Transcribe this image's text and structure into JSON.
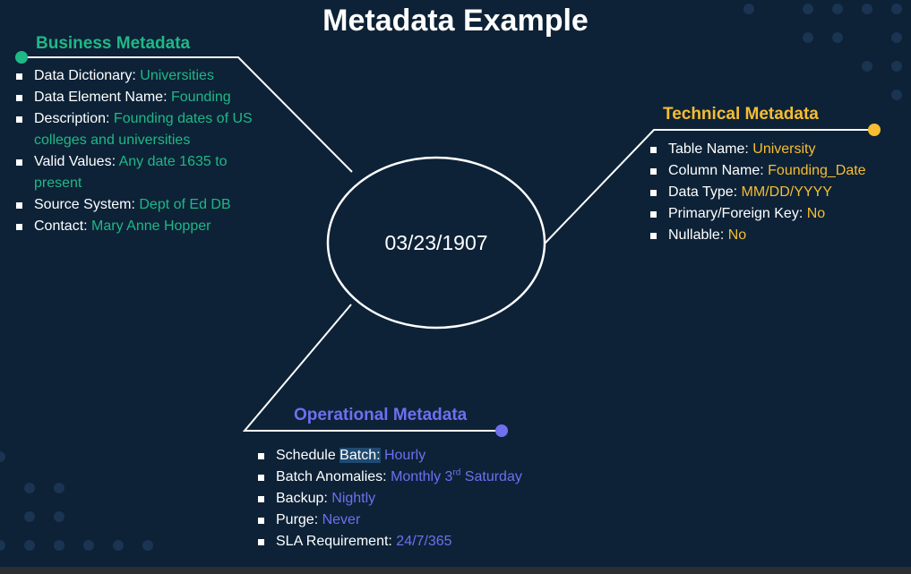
{
  "slide": {
    "title": "Metadata Example",
    "center_value": "03/23/1907"
  },
  "business": {
    "heading": "Business Metadata",
    "items": [
      {
        "label": "Data Dictionary: ",
        "value": "Universities"
      },
      {
        "label": "Data Element Name: ",
        "value": "Founding"
      },
      {
        "label": "Description: ",
        "value": "Founding dates of US colleges and universities"
      },
      {
        "label": "Valid Values: ",
        "value": "Any date 1635 to present"
      },
      {
        "label": "Source System: ",
        "value": "Dept of Ed DB"
      },
      {
        "label": "Contact: ",
        "value": "Mary Anne Hopper"
      }
    ]
  },
  "technical": {
    "heading": "Technical Metadata",
    "items": [
      {
        "label": "Table Name: ",
        "value": "University"
      },
      {
        "label": "Column Name: ",
        "value": "Founding_Date"
      },
      {
        "label": "Data Type: ",
        "value": "MM/DD/YYYY"
      },
      {
        "label": "Primary/Foreign Key: ",
        "value": "No"
      },
      {
        "label": "Nullable: ",
        "value": "No"
      }
    ]
  },
  "operational": {
    "heading": "Operational Metadata",
    "items": [
      {
        "label_pre": "Schedule ",
        "label_highlight": "Batch:",
        "value": " Hourly"
      },
      {
        "label": "Batch Anomalies: ",
        "value_pre": "Monthly 3",
        "value_sup": "rd",
        "value_post": " Saturday"
      },
      {
        "label": "Backup: ",
        "value": "Nightly"
      },
      {
        "label": "Purge: ",
        "value": "Never"
      },
      {
        "label": "SLA Requirement: ",
        "value": "24/7/365"
      }
    ]
  },
  "colors": {
    "background": "#0d2237",
    "business": "#1fb886",
    "technical": "#f6bd32",
    "operational": "#6f6ff0",
    "dots": "#1a3452"
  }
}
